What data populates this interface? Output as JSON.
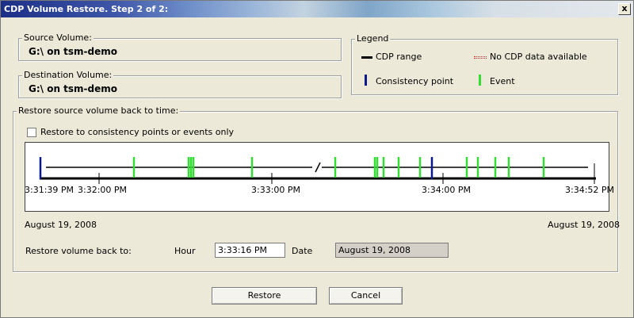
{
  "window": {
    "title": "CDP Volume Restore. Step 2 of 2:",
    "close_label": "x"
  },
  "source": {
    "label": "Source Volume:",
    "value": "G:\\ on tsm-demo"
  },
  "destination": {
    "label": "Destination Volume:",
    "value": "G:\\ on tsm-demo"
  },
  "legend": {
    "label": "Legend",
    "cdp_range": "CDP range",
    "no_cdp": "No CDP data available",
    "consistency_point": "Consistency point",
    "event": "Event",
    "colors": {
      "range": "#000000",
      "no_cdp": "#d03030",
      "consistency": "#0a1a8a",
      "event": "#33dd33"
    }
  },
  "restore_group": {
    "label": "Restore source volume back to time:",
    "checkbox_label": "Restore to consistency points or events only",
    "checked": false
  },
  "timeline": {
    "ticks": [
      "3:31:39 PM",
      "3:32:00 PM",
      "3:33:00 PM",
      "3:34:00 PM",
      "3:34:52 PM"
    ],
    "start_date": "August 19, 2008",
    "end_date": "August 19, 2008"
  },
  "restore_to": {
    "label": "Restore volume back to:",
    "hour_label": "Hour",
    "hour_value": "3:33:16 PM",
    "date_label": "Date",
    "date_value": "August 19, 2008"
  },
  "buttons": {
    "restore": "Restore",
    "cancel": "Cancel"
  }
}
